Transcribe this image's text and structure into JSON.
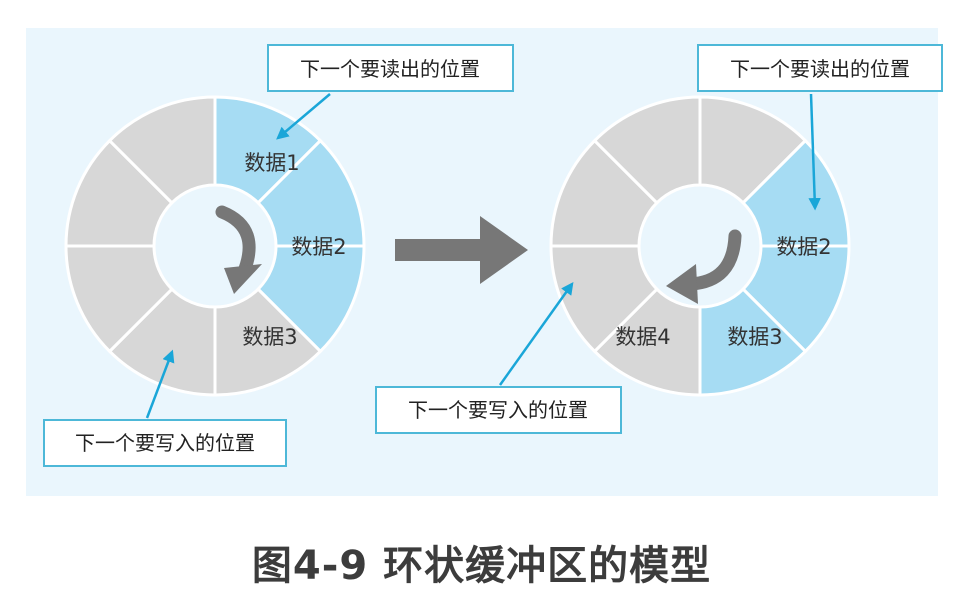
{
  "caption": "图4-9 环状缓冲区的模型",
  "colors": {
    "panel": "#eaf6fd",
    "segment_empty": "#d7d7d7",
    "segment_data": "#a6dcf3",
    "arrow_gray": "#777777",
    "callout_border": "#4db8d8",
    "pointer": "#1aa6d8"
  },
  "left_ring": {
    "data_labels": [
      "数据1",
      "数据2",
      "数据3"
    ],
    "read_callout": "下一个要读出的位置",
    "write_callout": "下一个要写入的位置"
  },
  "right_ring": {
    "data_labels": [
      "数据2",
      "数据3",
      "数据4"
    ],
    "read_callout": "下一个要读出的位置",
    "write_callout": "下一个要写入的位置"
  },
  "transition_arrow": "arrow-right-icon"
}
